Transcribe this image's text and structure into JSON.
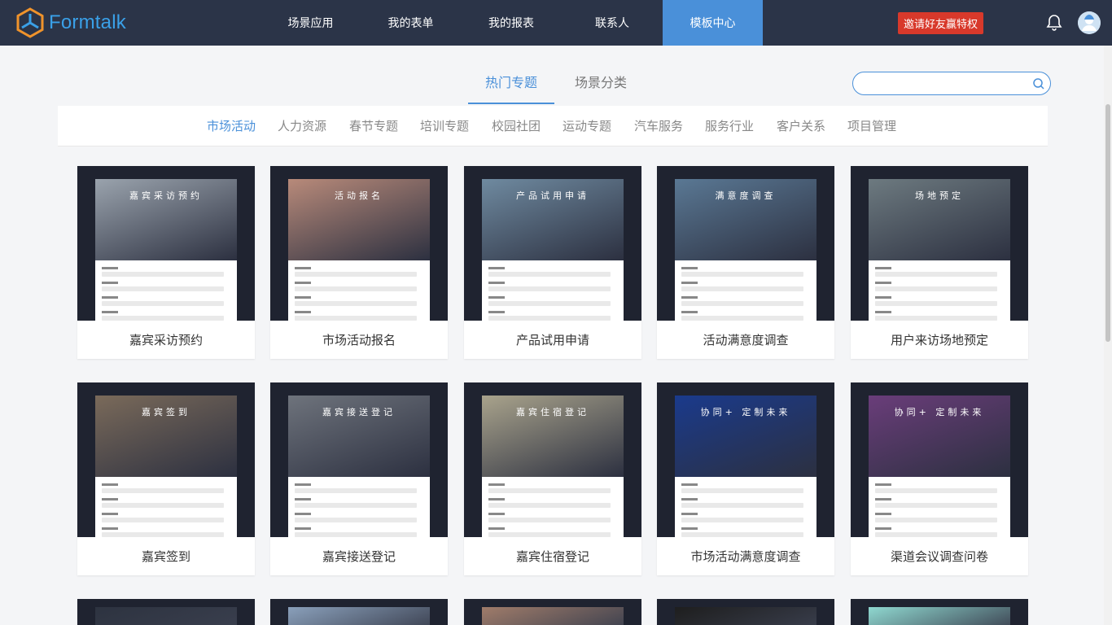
{
  "brand": {
    "name": "Formtalk",
    "accent": "#3aa0e8"
  },
  "nav": {
    "items": [
      {
        "label": "场景应用"
      },
      {
        "label": "我的表单"
      },
      {
        "label": "我的报表"
      },
      {
        "label": "联系人"
      },
      {
        "label": "模板中心",
        "active": true
      }
    ],
    "invite_label": "邀请好友赢特权"
  },
  "main_tabs": [
    {
      "label": "热门专题",
      "active": true
    },
    {
      "label": "场景分类"
    }
  ],
  "search": {
    "placeholder": "",
    "value": ""
  },
  "categories": [
    {
      "label": "市场活动",
      "active": true
    },
    {
      "label": "人力资源"
    },
    {
      "label": "春节专题"
    },
    {
      "label": "培训专题"
    },
    {
      "label": "校园社团"
    },
    {
      "label": "运动专题"
    },
    {
      "label": "汽车服务"
    },
    {
      "label": "服务行业"
    },
    {
      "label": "客户关系"
    },
    {
      "label": "项目管理"
    }
  ],
  "templates": [
    {
      "title": "嘉宾采访预约",
      "banner": "嘉宾采访预约",
      "theme": "#9aa3ad"
    },
    {
      "title": "市场活动报名",
      "banner": "活动报名",
      "theme": "#b88a7a"
    },
    {
      "title": "产品试用申请",
      "banner": "产品试用申请",
      "theme": "#6f8aa0"
    },
    {
      "title": "活动满意度调查",
      "banner": "满意度调查",
      "theme": "#5a7894"
    },
    {
      "title": "用户来访场地预定",
      "banner": "场地预定",
      "theme": "#6d7a80"
    },
    {
      "title": "嘉宾签到",
      "banner": "嘉宾签到",
      "theme": "#7a6a5a"
    },
    {
      "title": "嘉宾接送登记",
      "banner": "嘉宾接送登记",
      "theme": "#6e737c"
    },
    {
      "title": "嘉宾住宿登记",
      "banner": "嘉宾住宿登记",
      "theme": "#a9a38c"
    },
    {
      "title": "市场活动满意度调查",
      "banner": "协同+ 定制未来",
      "theme": "#1a3a8c"
    },
    {
      "title": "渠道会议调查问卷",
      "banner": "协同+ 定制未来",
      "theme": "#6a3d7a"
    }
  ],
  "partial_row_themes": [
    "#2d3340",
    "#8aa0bb",
    "#a07c6a",
    "#1e1e1e",
    "#8fd8d0"
  ],
  "colors": {
    "topbar": "#2b3448",
    "active_nav": "#4a90d9",
    "invite": "#d8392b"
  }
}
